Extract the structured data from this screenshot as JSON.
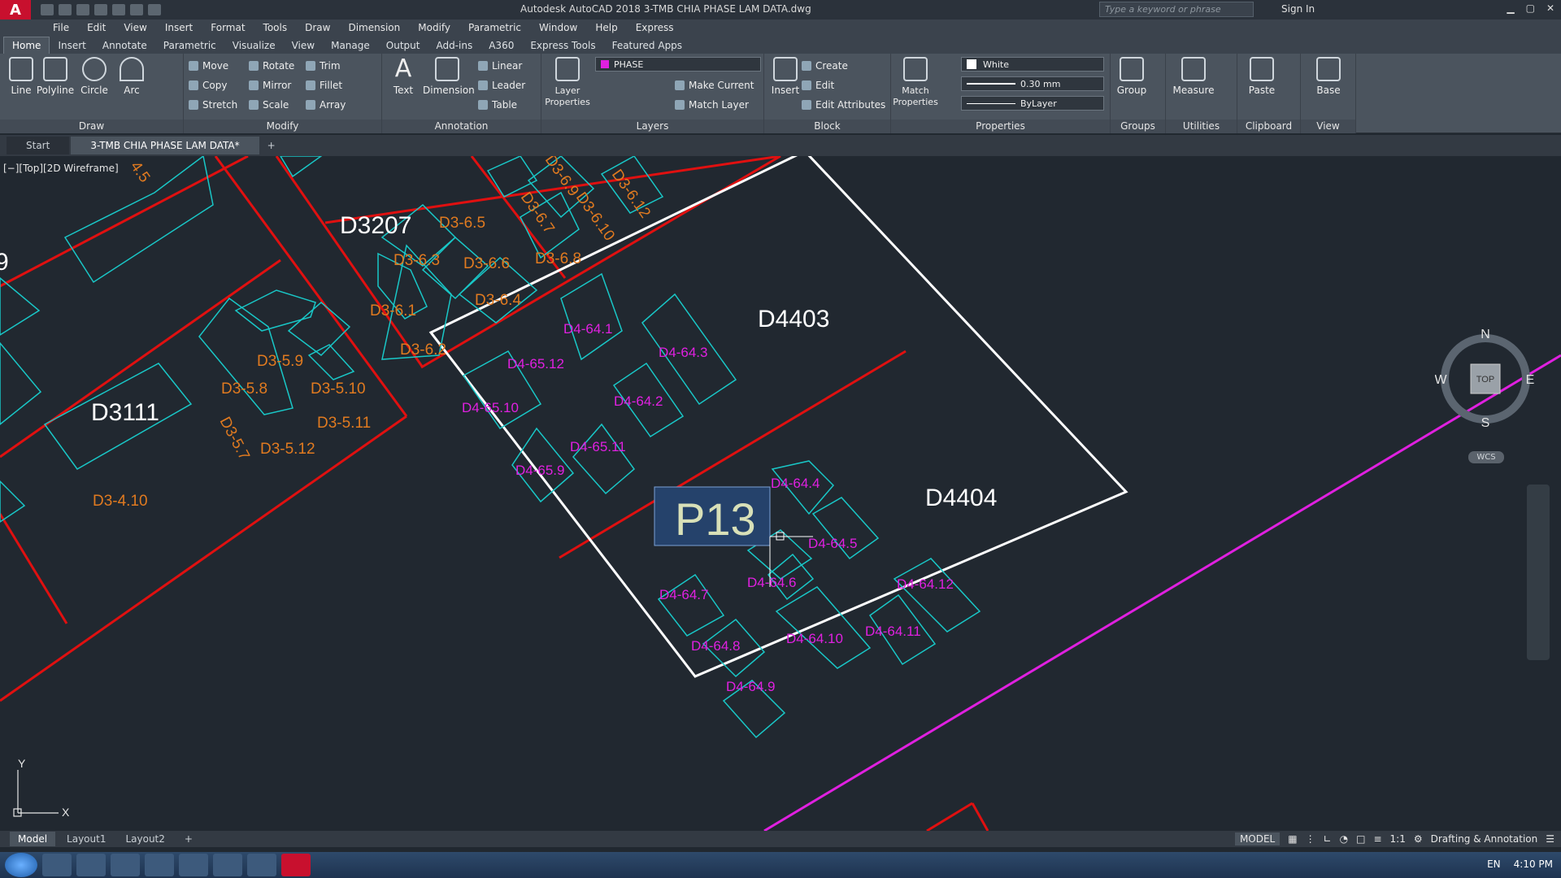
{
  "titlebar": {
    "app_title": "Autodesk AutoCAD 2018   3-TMB CHIA PHASE LAM DATA.dwg",
    "search_placeholder": "Type a keyword or phrase",
    "sign_in": "Sign In"
  },
  "menu": [
    "File",
    "Edit",
    "View",
    "Insert",
    "Format",
    "Tools",
    "Draw",
    "Dimension",
    "Modify",
    "Parametric",
    "Window",
    "Help",
    "Express"
  ],
  "ribbon_tabs": [
    "Home",
    "Insert",
    "Annotate",
    "Parametric",
    "Visualize",
    "View",
    "Manage",
    "Output",
    "Add-ins",
    "A360",
    "Express Tools",
    "Featured Apps"
  ],
  "ribbon": {
    "draw": {
      "label": "Draw",
      "line": "Line",
      "polyline": "Polyline",
      "circle": "Circle",
      "arc": "Arc"
    },
    "modify": {
      "label": "Modify",
      "move": "Move",
      "rotate": "Rotate",
      "trim": "Trim",
      "copy": "Copy",
      "mirror": "Mirror",
      "fillet": "Fillet",
      "stretch": "Stretch",
      "scale": "Scale",
      "array": "Array"
    },
    "annotation": {
      "label": "Annotation",
      "text": "Text",
      "dimension": "Dimension",
      "linear": "Linear",
      "leader": "Leader",
      "table": "Table"
    },
    "layers": {
      "label": "Layers",
      "layer_properties": "Layer Properties",
      "current_layer": "PHASE",
      "make_current": "Make Current",
      "match_layer": "Match Layer"
    },
    "block": {
      "label": "Block",
      "insert": "Insert",
      "create": "Create",
      "edit": "Edit",
      "edit_attributes": "Edit Attributes"
    },
    "properties": {
      "label": "Properties",
      "match": "Match Properties",
      "color": "White",
      "lineweight": "0.30 mm",
      "linetype": "ByLayer"
    },
    "groups": {
      "label": "Groups",
      "group": "Group"
    },
    "utilities": {
      "label": "Utilities",
      "measure": "Measure"
    },
    "clipboard": {
      "label": "Clipboard",
      "paste": "Paste"
    },
    "view": {
      "label": "View",
      "base": "Base"
    }
  },
  "doc_tabs": [
    "Start",
    "3-TMB CHIA PHASE LAM DATA*"
  ],
  "viewport_label": "[−][Top][2D Wireframe]",
  "viewcube": {
    "n": "N",
    "s": "S",
    "e": "E",
    "w": "W",
    "top": "TOP",
    "wcs": "WCS"
  },
  "drawing": {
    "blocks": {
      "d3207": "D3207",
      "d3111": "D3111",
      "d4403": "D4403",
      "d4404": "D4404",
      "p13": "P13",
      "left9": "9"
    },
    "orange_labels": [
      "D3-6.5",
      "D3-6.3",
      "D3-6.6",
      "D3-6.8",
      "D3-6.1",
      "D3-6.4",
      "D3-6.2",
      "D3-6.7",
      "D3-6.10",
      "D3-6.12",
      "D3-6.9",
      "D3-5.9",
      "D3-5.8",
      "D3-5.10",
      "D3-5.11",
      "D3-5.7",
      "D3-5.12",
      "D3-4.10",
      "4.5"
    ],
    "magenta_labels": [
      "D4-64.1",
      "D4-64.3",
      "D4-65.12",
      "D4-64.2",
      "D4-65.10",
      "D4-65.11",
      "D4-65.9",
      "D4-64.4",
      "D4-64.5",
      "D4-64.6",
      "D4-64.7",
      "D4-64.12",
      "D4-64.8",
      "D4-64.10",
      "D4-64.11",
      "D4-64.9"
    ],
    "colors": {
      "red": "#e01010",
      "cyan": "#19c7c7",
      "white": "#ffffff",
      "magenta": "#e020e0",
      "orange": "#e07a20",
      "background": "#212830"
    }
  },
  "layout_tabs": [
    "Model",
    "Layout1",
    "Layout2"
  ],
  "status": {
    "model": "MODEL",
    "scale": "1:1",
    "workspace": "Drafting & Annotation"
  },
  "taskbar": {
    "lang": "EN",
    "time": "4:10 PM"
  }
}
